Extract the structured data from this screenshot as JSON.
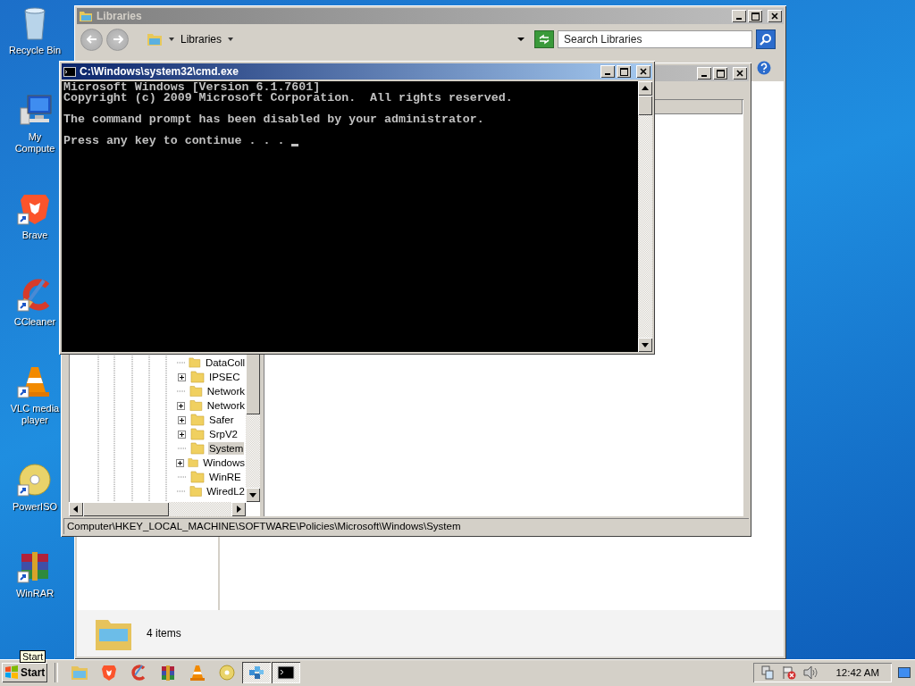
{
  "desktop_icons": [
    {
      "label": "Recycle Bin",
      "kind": "recycle",
      "shortcut": false
    },
    {
      "label": "My Compute",
      "kind": "computer",
      "shortcut": false
    },
    {
      "label": "Brave",
      "kind": "brave",
      "shortcut": true
    },
    {
      "label": "CCleaner",
      "kind": "ccleaner",
      "shortcut": true
    },
    {
      "label": "VLC media player",
      "kind": "vlc",
      "shortcut": true
    },
    {
      "label": "PowerISO",
      "kind": "disc",
      "shortcut": true
    },
    {
      "label": "WinRAR",
      "kind": "winrar",
      "shortcut": true
    }
  ],
  "libraries": {
    "title": "Libraries",
    "address": "Libraries",
    "search": {
      "placeholder": "Search Libraries"
    },
    "status": "4 items"
  },
  "regedit": {
    "tree": [
      {
        "label": "DataColl",
        "has_children": false,
        "selected": false
      },
      {
        "label": "IPSEC",
        "has_children": true,
        "selected": false
      },
      {
        "label": "Network",
        "has_children": false,
        "selected": false
      },
      {
        "label": "Network",
        "has_children": true,
        "selected": false
      },
      {
        "label": "Safer",
        "has_children": true,
        "selected": false
      },
      {
        "label": "SrpV2",
        "has_children": true,
        "selected": false
      },
      {
        "label": "System",
        "has_children": false,
        "selected": true
      },
      {
        "label": "Windows",
        "has_children": true,
        "selected": false
      },
      {
        "label": "WinRE",
        "has_children": false,
        "selected": false
      },
      {
        "label": "WiredL2",
        "has_children": false,
        "selected": false
      }
    ],
    "status_bar": "Computer\\HKEY_LOCAL_MACHINE\\SOFTWARE\\Policies\\Microsoft\\Windows\\System"
  },
  "cmd": {
    "title": "C:\\Windows\\system32\\cmd.exe",
    "blocks": [
      [
        "Microsoft Windows [Version 6.1.7601]",
        "Copyright (c) 2009 Microsoft Corporation.  All rights reserved."
      ],
      [
        "The command prompt has been disabled by your administrator."
      ],
      [
        "Press any key to continue . . ."
      ]
    ]
  },
  "taskbar": {
    "start": "Start",
    "tooltip": "Start",
    "apps": [
      {
        "kind": "explorer",
        "active": false
      },
      {
        "kind": "brave",
        "active": false
      },
      {
        "kind": "ccleaner",
        "active": false
      },
      {
        "kind": "winrar",
        "active": false
      },
      {
        "kind": "vlc",
        "active": false
      },
      {
        "kind": "disc",
        "active": false
      },
      {
        "kind": "regedit",
        "active": true
      },
      {
        "kind": "cmd",
        "active": true
      }
    ],
    "clock": "12:42 AM"
  }
}
